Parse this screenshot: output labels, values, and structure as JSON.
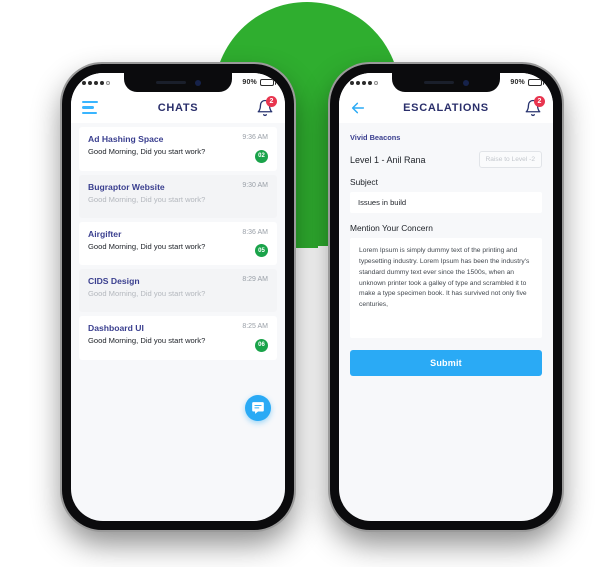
{
  "colors": {
    "blob_green": "#2fae2f",
    "accent_blue": "#2aaaf5",
    "title_navy": "#2a2f6b",
    "badge_red": "#e8354f",
    "badge_green": "#1aa34a"
  },
  "left_phone": {
    "status": {
      "battery_percent": "90%",
      "signal_dots_filled": 4,
      "signal_dots_total": 5
    },
    "appbar": {
      "title": "CHATS",
      "menu_icon": "hamburger-menu-icon",
      "bell_icon": "bell-icon",
      "bell_badge": "2"
    },
    "chats": [
      {
        "name": "Ad Hashing Space",
        "message": "Good Morning, Did you start work?",
        "time": "9:36 AM",
        "unread": "02",
        "read": false
      },
      {
        "name": "Bugraptor Website",
        "message": "Good Morning, Did you start work?",
        "time": "9:30 AM",
        "unread": "",
        "read": true
      },
      {
        "name": "Airgifter",
        "message": "Good Morning, Did you start work?",
        "time": "8:36 AM",
        "unread": "05",
        "read": false
      },
      {
        "name": "CIDS Design",
        "message": "Good Morning, Did you start work?",
        "time": "8:29 AM",
        "unread": "",
        "read": true
      },
      {
        "name": "Dashboard UI",
        "message": "Good Morning, Did you start work?",
        "time": "8:25 AM",
        "unread": "06",
        "read": false
      }
    ],
    "fab": {
      "icon": "chat-bubble-icon"
    }
  },
  "right_phone": {
    "status": {
      "battery_percent": "90%",
      "signal_dots_filled": 4,
      "signal_dots_total": 5
    },
    "appbar": {
      "title": "ESCALATIONS",
      "back_icon": "back-arrow-icon",
      "bell_icon": "bell-icon",
      "bell_badge": "2"
    },
    "form": {
      "company": "Vivid Beacons",
      "level_label": "Level 1 - Anil Rana",
      "raise_button": "Raise to Level -2",
      "subject_label": "Subject",
      "subject_value": "Issues in build",
      "concern_label": "Mention Your Concern",
      "concern_value": "Lorem Ipsum is simply dummy text of the printing and typesetting industry. Lorem Ipsum has been the industry's standard dummy text ever since the 1500s, when an unknown printer took a galley of type and scrambled it to make a type specimen book. It has survived not only five centuries,",
      "submit_label": "Submit"
    }
  }
}
